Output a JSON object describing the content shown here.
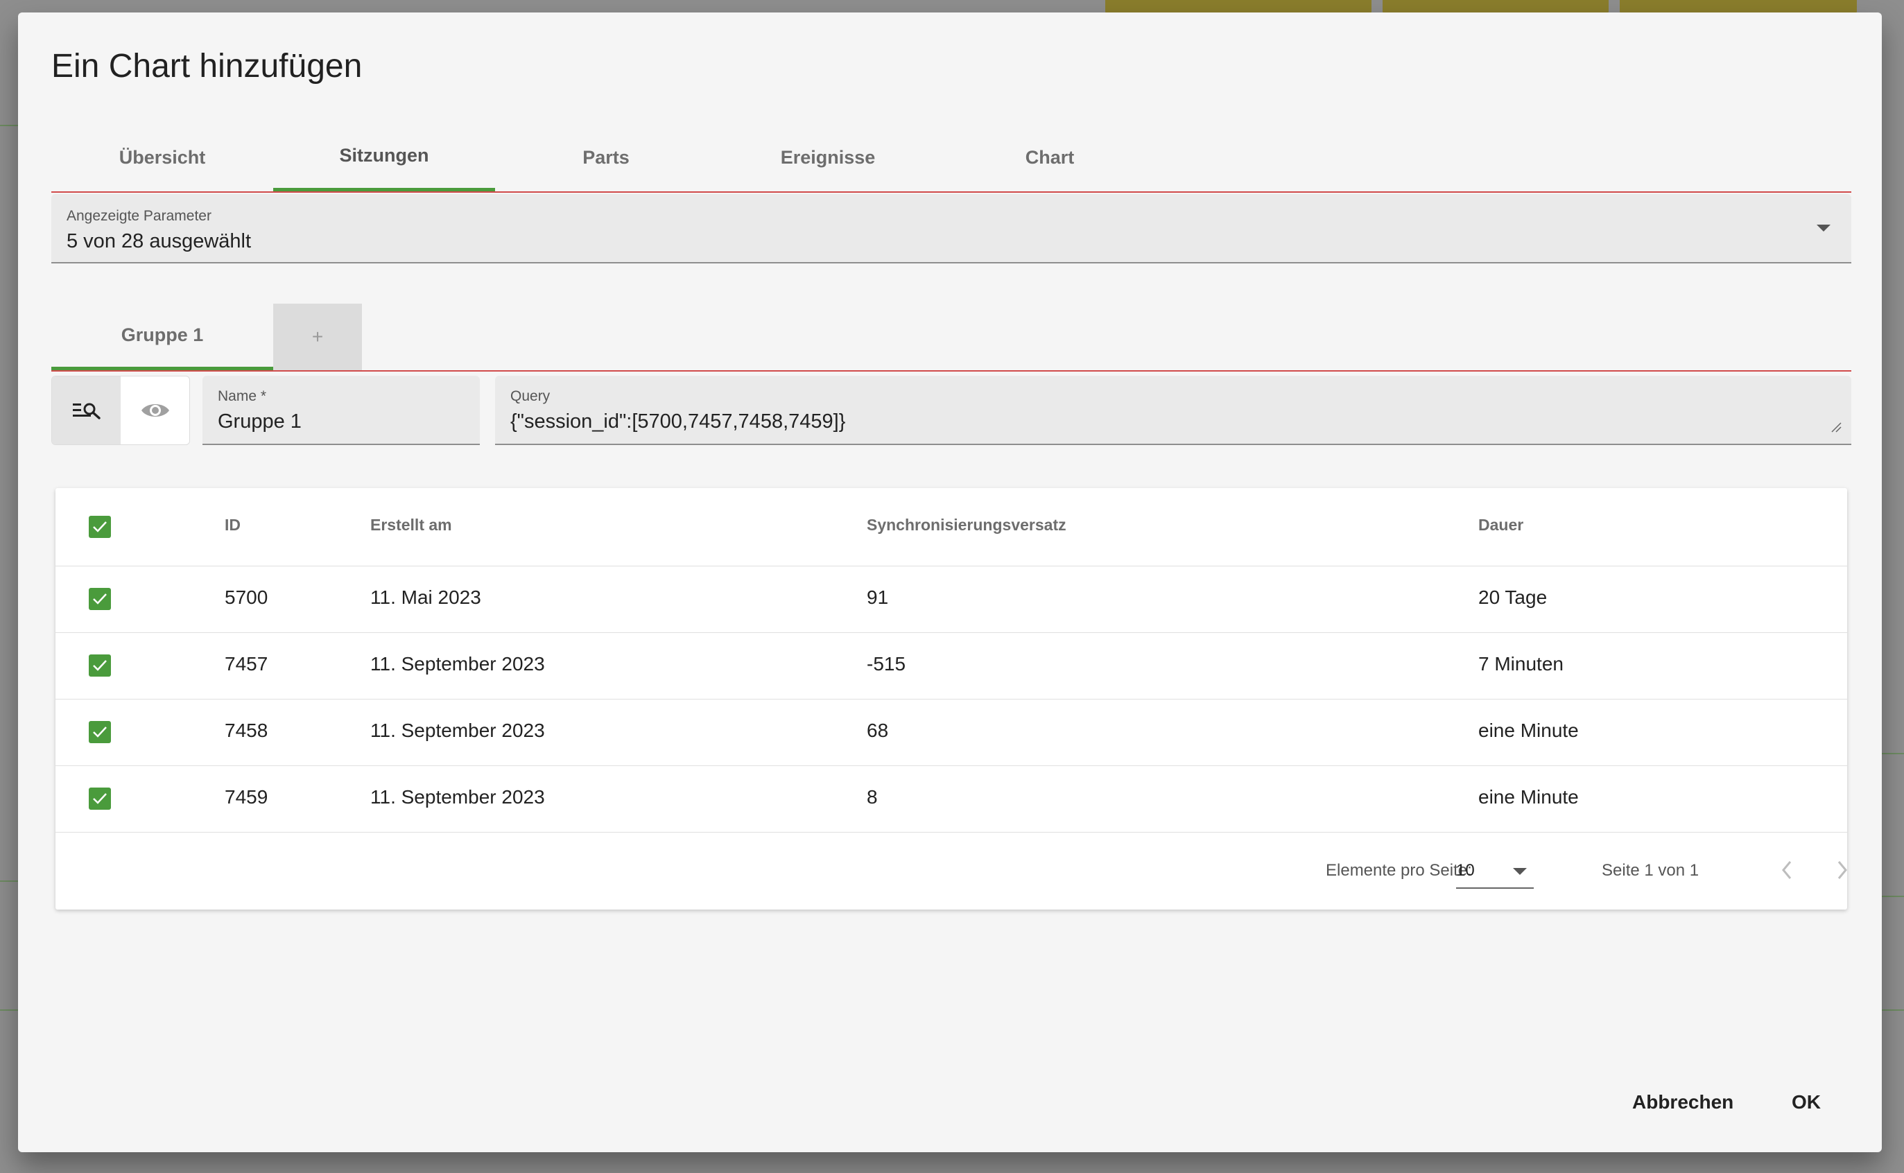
{
  "dialog": {
    "title": "Ein Chart hinzufügen",
    "tabs": [
      {
        "label": "Übersicht"
      },
      {
        "label": "Sitzungen"
      },
      {
        "label": "Parts"
      },
      {
        "label": "Ereignisse"
      },
      {
        "label": "Chart"
      }
    ],
    "active_tab": "Sitzungen"
  },
  "parameters": {
    "label": "Angezeigte Parameter",
    "value": "5 von 28 ausgewählt"
  },
  "groups": {
    "tabs": [
      {
        "label": "Gruppe 1"
      }
    ],
    "add_label": "+"
  },
  "toggles": {
    "query_icon": "search-list-icon",
    "view_icon": "eye-icon"
  },
  "name_field": {
    "label": "Name *",
    "value": "Gruppe 1"
  },
  "query_field": {
    "label": "Query",
    "value": "{\"session_id\":[5700,7457,7458,7459]}"
  },
  "table": {
    "headers": {
      "id": "ID",
      "created": "Erstellt am",
      "sync_offset": "Synchronisierungsversatz",
      "duration": "Dauer"
    },
    "rows": [
      {
        "id": "5700",
        "created": "11. Mai 2023",
        "sync_offset": "91",
        "duration": "20 Tage",
        "checked": true
      },
      {
        "id": "7457",
        "created": "11. September 2023",
        "sync_offset": "-515",
        "duration": "7 Minuten",
        "checked": true
      },
      {
        "id": "7458",
        "created": "11. September 2023",
        "sync_offset": "68",
        "duration": "eine Minute",
        "checked": true
      },
      {
        "id": "7459",
        "created": "11. September 2023",
        "sync_offset": "8",
        "duration": "eine Minute",
        "checked": true
      }
    ]
  },
  "paginator": {
    "items_per_page_label": "Elemente pro Seite:",
    "items_per_page": "10",
    "range_label": "Seite 1 von 1"
  },
  "actions": {
    "cancel": "Abbrechen",
    "ok": "OK"
  },
  "colors": {
    "accent": "#4a9b3c",
    "tab_underline": "#d14b4b",
    "background_button": "#8a7d2c"
  }
}
